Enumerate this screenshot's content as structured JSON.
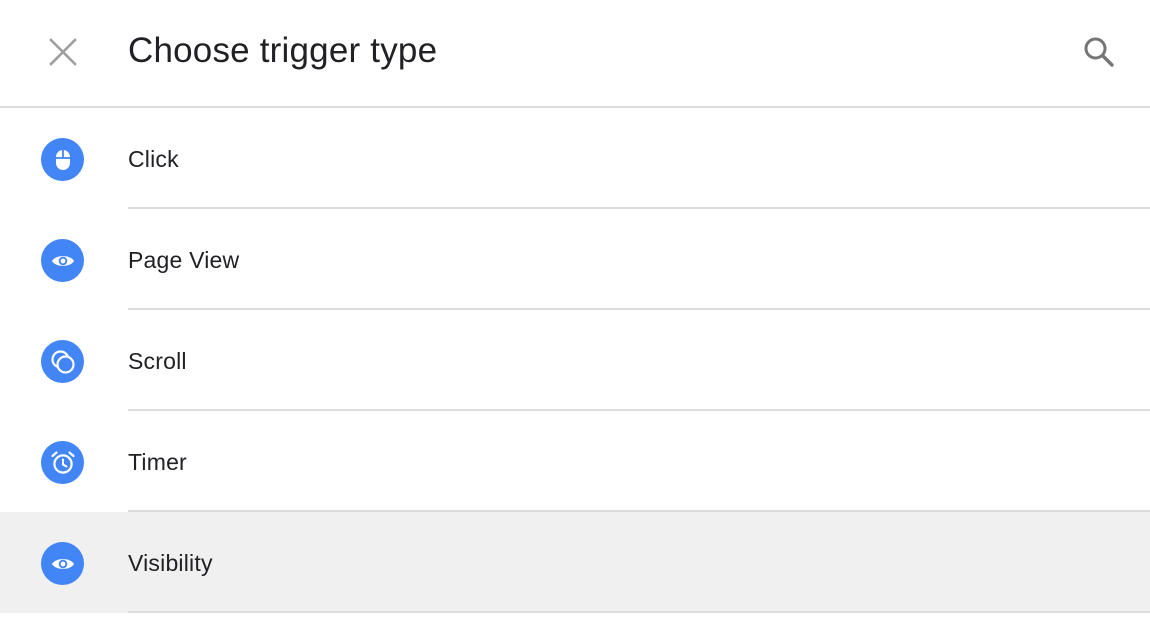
{
  "dialog": {
    "title": "Choose trigger type",
    "close_icon": "close-icon",
    "search_icon": "search-icon"
  },
  "triggers": [
    {
      "label": "Click",
      "icon": "mouse-icon"
    },
    {
      "label": "Page View",
      "icon": "eye-icon"
    },
    {
      "label": "Scroll",
      "icon": "scroll-icon"
    },
    {
      "label": "Timer",
      "icon": "alarm-clock-icon"
    },
    {
      "label": "Visibility",
      "icon": "eye-icon",
      "selected": true
    }
  ],
  "colors": {
    "accent": "#4285f4",
    "selected_background": "#f0f0f0",
    "divider": "#dcdcdc",
    "text": "#202124",
    "icon_gray": "#757575"
  }
}
